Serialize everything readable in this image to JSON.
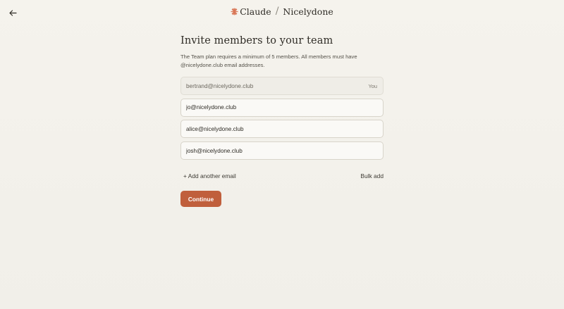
{
  "header": {
    "brand_name": "Claude",
    "separator": "/",
    "org_name": "Nicelydone",
    "accent_color": "#d97757"
  },
  "main": {
    "title": "Invite members to your team",
    "description": "The Team plan requires a minimum of 5 members. All members must have @nicelydone.club email addresses.",
    "emails": [
      {
        "value": "bertrand@nicelydone.club",
        "tag": "You"
      },
      {
        "value": "jo@nicelydone.club"
      },
      {
        "value": "alice@nicelydone.club"
      },
      {
        "value": "josh@nicelydone.club"
      }
    ],
    "add_email_label": "+ Add another email",
    "bulk_add_label": "Bulk add",
    "continue_label": "Continue",
    "button_color": "#c05f3c"
  }
}
